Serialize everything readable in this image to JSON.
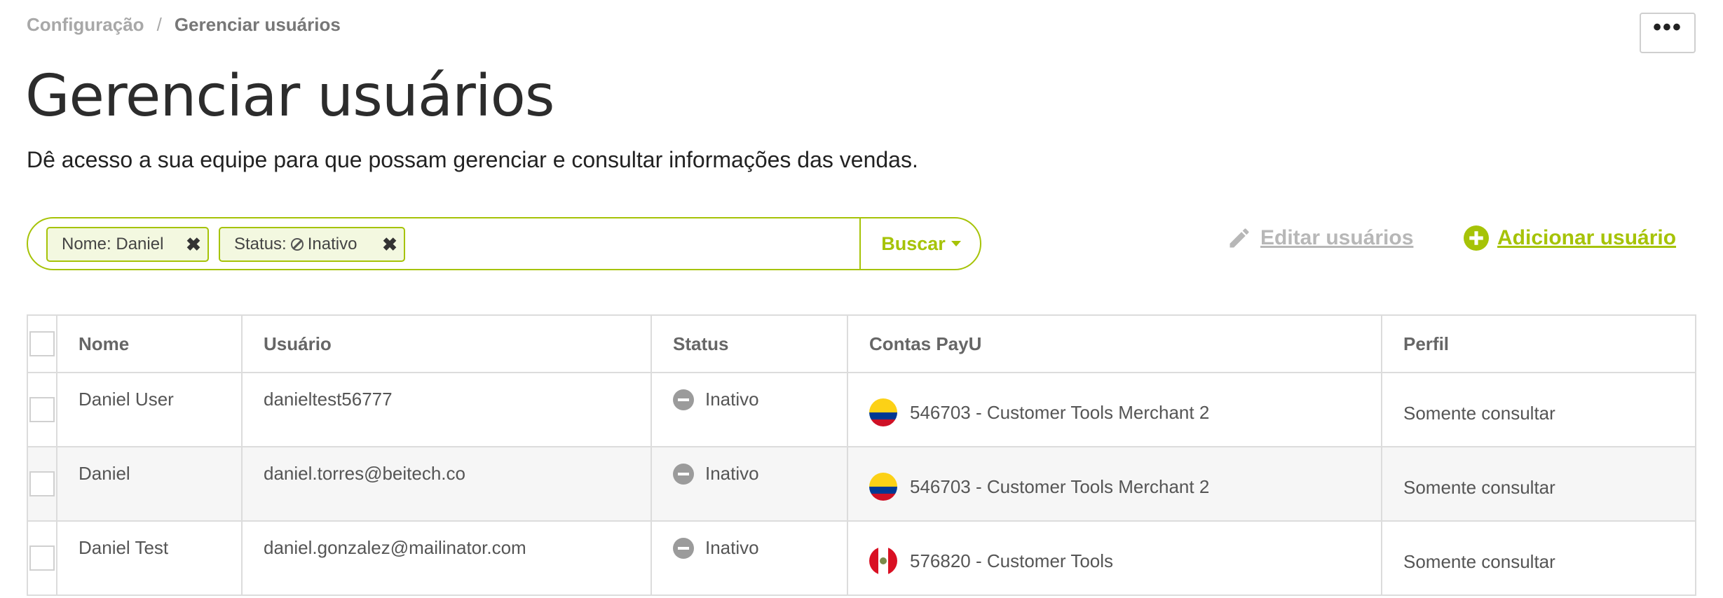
{
  "breadcrumb": {
    "parent": "Configuração",
    "separator": "/",
    "current": "Gerenciar usuários"
  },
  "more_button_label": "•••",
  "page_title": "Gerenciar usuários",
  "subtitle": "Dê acesso a sua equipe para que possam gerenciar e consultar informações das vendas.",
  "filters": {
    "chips": [
      {
        "label": "Nome: Daniel"
      },
      {
        "prefix": "Status:",
        "icon": "ban-icon",
        "value": "Inativo"
      }
    ],
    "remove_glyph": "✖",
    "search_label": "Buscar"
  },
  "actions": {
    "edit_label": "Editar usuários",
    "add_label": "Adicionar usuário"
  },
  "table": {
    "headers": [
      "Nome",
      "Usuário",
      "Status",
      "Contas PayU",
      "Perfil"
    ],
    "rows": [
      {
        "name": "Daniel User",
        "user": "danieltest56777",
        "status": "Inativo",
        "account": "546703 - Customer Tools Merchant 2",
        "flag": "colombia-flag-icon",
        "profile": "Somente consultar"
      },
      {
        "name": "Daniel",
        "user": "daniel.torres@beitech.co",
        "status": "Inativo",
        "account": "546703 - Customer Tools Merchant 2",
        "flag": "colombia-flag-icon",
        "profile": "Somente consultar"
      },
      {
        "name": "Daniel Test",
        "user": "daniel.gonzalez@mailinator.com",
        "status": "Inativo",
        "account": "576820 - Customer Tools",
        "flag": "peru-flag-icon",
        "profile": "Somente consultar"
      }
    ]
  },
  "colors": {
    "accent": "#a6c307",
    "muted_link": "#b7b7b7",
    "status_inactive": "#9b9b9b"
  }
}
